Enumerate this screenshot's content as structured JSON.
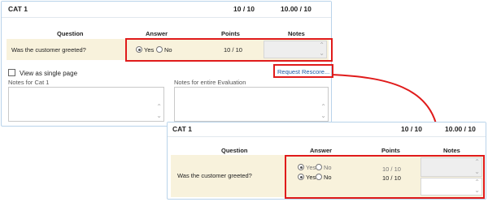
{
  "top_panel": {
    "title": "CAT 1",
    "score": "10 / 10",
    "total": "10.00 / 10",
    "columns": {
      "question": "Question",
      "answer": "Answer",
      "points": "Points",
      "notes": "Notes"
    },
    "row": {
      "question": "Was the customer greeted?",
      "yes": "Yes",
      "no": "No",
      "points": "10 / 10"
    },
    "view_single": "View as single page",
    "notes_cat_label": "Notes for Cat 1",
    "notes_eval_label": "Notes for entire Evaluation",
    "request_link": "Request Rescore..."
  },
  "bottom_panel": {
    "title": "CAT 1",
    "score": "10 / 10",
    "total": "10.00 / 10",
    "columns": {
      "question": "Question",
      "answer": "Answer",
      "points": "Points",
      "notes": "Notes"
    },
    "row": {
      "question": "Was the customer greeted?",
      "yes": "Yes",
      "no": "No",
      "points_1": "10 / 10",
      "points_2": "10 / 10"
    }
  },
  "colors": {
    "accent_red": "#e01b1b",
    "link_blue": "#1d5aa6",
    "row_band": "#f8f2dc",
    "panel_border": "#b9d3ea"
  }
}
